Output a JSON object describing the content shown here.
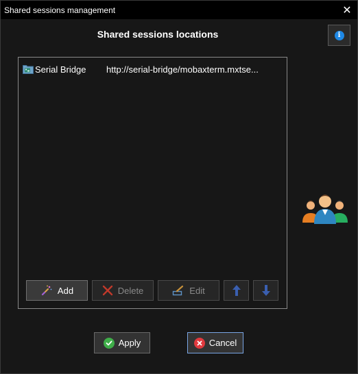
{
  "window": {
    "title": "Shared sessions management",
    "close_glyph": "✕"
  },
  "heading": "Shared sessions locations",
  "info_button": {
    "icon": "info-icon",
    "glyph": "i"
  },
  "sessions": [
    {
      "icon": "folder-session-icon",
      "name": "Serial Bridge",
      "url": "http://serial-bridge/mobaxterm.mxtse..."
    }
  ],
  "toolbar": {
    "add_label": "Add",
    "delete_label": "Delete",
    "edit_label": "Edit",
    "move_up_icon": "arrow-up-icon",
    "move_down_icon": "arrow-down-icon"
  },
  "footer": {
    "apply_label": "Apply",
    "cancel_label": "Cancel"
  },
  "colors": {
    "background": "#171717",
    "titlebar": "#000000",
    "apply_green": "#3fae49",
    "cancel_red": "#e0393e",
    "info_blue": "#1e88e5",
    "arrow_blue": "#3a5fb0"
  }
}
